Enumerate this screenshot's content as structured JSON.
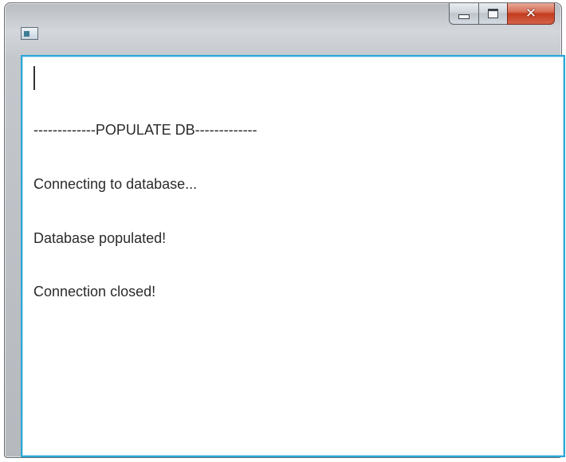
{
  "window": {
    "icon": "app-window-icon",
    "buttons": {
      "minimize_icon": "minimize-icon",
      "maximize_icon": "maximize-icon",
      "close_label": "✕"
    }
  },
  "textarea": {
    "lines": [
      "-------------POPULATE DB-------------",
      "Connecting to database...",
      "Database populated!",
      "Connection closed!"
    ]
  },
  "colors": {
    "focus_border": "#2aa8d8",
    "close_button": "#c33c1e"
  }
}
